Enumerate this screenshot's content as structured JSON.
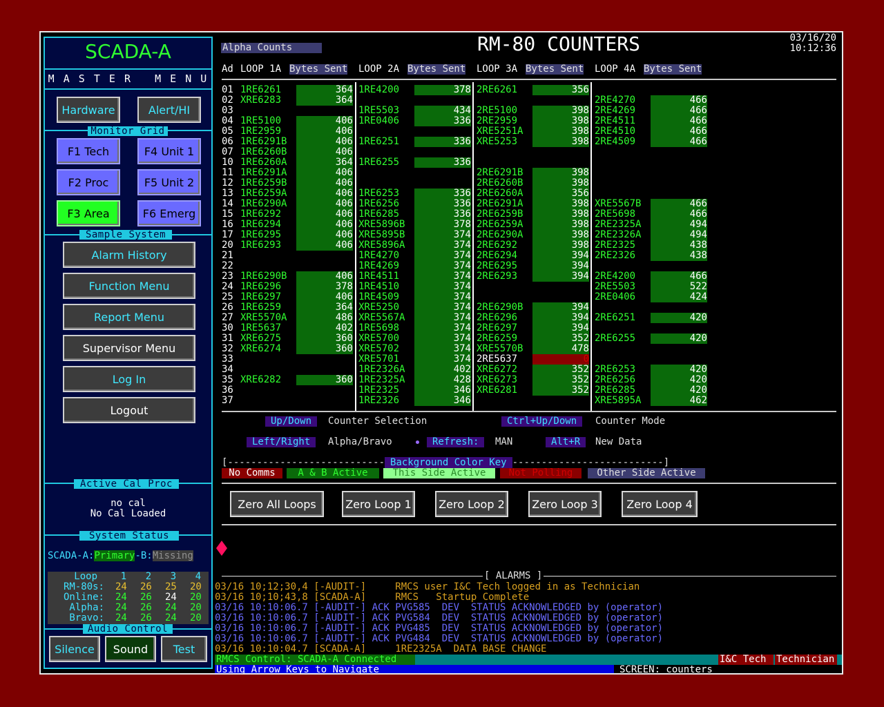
{
  "left": {
    "title": "SCADA-A",
    "master_menu": "M A S T E R   M E N U",
    "hardware": "Hardware",
    "alert": "Alert/HI",
    "monitor_grid": "Monitor Grid",
    "f1": "F1 Tech",
    "f2": "F2 Proc",
    "f3": "F3 Area",
    "f4": "F4 Unit 1",
    "f5": "F5 Unit 2",
    "f6": "F6 Emerg",
    "sample_system": "Sample System",
    "menu": [
      "Alarm History",
      "Function Menu",
      "Report Menu",
      "Supervisor Menu",
      "Log In",
      "Logout"
    ],
    "active_cal": "Active Cal Proc",
    "cal1": "no cal",
    "cal2": "No Cal Loaded",
    "system_status": "System  Status",
    "status_prefix": "SCADA-A:",
    "status_primary": "Primary",
    "status_b": "-B:",
    "status_missing": "Missing",
    "loop_table": {
      "header": [
        "Loop",
        "1",
        "2",
        "3",
        "4"
      ],
      "rows": [
        {
          "label": "RM-80s:",
          "v": [
            "24",
            "26",
            "25",
            "20"
          ]
        },
        {
          "label": "Online:",
          "v": [
            "24",
            "26",
            "24",
            "20"
          ]
        },
        {
          "label": "Alpha:",
          "v": [
            "24",
            "26",
            "24",
            "20"
          ]
        },
        {
          "label": "Bravo:",
          "v": [
            "24",
            "26",
            "24",
            "20"
          ]
        }
      ]
    },
    "audio_control": "Audio Control",
    "silence": "Silence",
    "sound": "Sound",
    "test": "Test"
  },
  "header": {
    "alpha_counts": "Alpha Counts",
    "title": "RM-80 COUNTERS",
    "date": "03/16/20",
    "time": "10:12:36"
  },
  "columns": {
    "ad": "Ad",
    "loop_labels": [
      "LOOP 1A",
      "LOOP 2A",
      "LOOP 3A",
      "LOOP 4A"
    ],
    "bytes_sent": "Bytes Sent"
  },
  "addresses": [
    "01",
    "02",
    "03",
    "04",
    "05",
    "06",
    "07",
    "10",
    "11",
    "12",
    "13",
    "14",
    "15",
    "16",
    "17",
    "20",
    "21",
    "22",
    "23",
    "24",
    "25",
    "26",
    "27",
    "30",
    "31",
    "32",
    "33",
    "34",
    "35",
    "36",
    "37"
  ],
  "loops": [
    {
      "loop": "1A",
      "rows": [
        {
          "r": 0,
          "name": "1RE6261",
          "val": "364"
        },
        {
          "r": 1,
          "name": "XRE6283",
          "val": "364"
        },
        {
          "r": 3,
          "name": "1RE5100",
          "val": "406"
        },
        {
          "r": 4,
          "name": "1RE2959",
          "val": "406"
        },
        {
          "r": 5,
          "name": "1RE6291B",
          "val": "406"
        },
        {
          "r": 6,
          "name": "1RE6260B",
          "val": "406"
        },
        {
          "r": 7,
          "name": "1RE6260A",
          "val": "364"
        },
        {
          "r": 8,
          "name": "1RE6291A",
          "val": "406"
        },
        {
          "r": 9,
          "name": "1RE6259B",
          "val": "406"
        },
        {
          "r": 10,
          "name": "1RE6259A",
          "val": "406"
        },
        {
          "r": 11,
          "name": "1RE6290A",
          "val": "406"
        },
        {
          "r": 12,
          "name": "1RE6292",
          "val": "406"
        },
        {
          "r": 13,
          "name": "1RE6294",
          "val": "406"
        },
        {
          "r": 14,
          "name": "1RE6295",
          "val": "406"
        },
        {
          "r": 15,
          "name": "1RE6293",
          "val": "406"
        },
        {
          "r": 18,
          "name": "1RE6290B",
          "val": "406"
        },
        {
          "r": 19,
          "name": "1RE6296",
          "val": "378"
        },
        {
          "r": 20,
          "name": "1RE6297",
          "val": "406"
        },
        {
          "r": 21,
          "name": "1RE6259",
          "val": "364"
        },
        {
          "r": 22,
          "name": "XRE5570A",
          "val": "486"
        },
        {
          "r": 23,
          "name": "1RE5637",
          "val": "402"
        },
        {
          "r": 24,
          "name": "XRE6275",
          "val": "360"
        },
        {
          "r": 25,
          "name": "XRE6274",
          "val": "360"
        },
        {
          "r": 28,
          "name": "XRE6282",
          "val": "360"
        }
      ]
    },
    {
      "loop": "2A",
      "rows": [
        {
          "r": 0,
          "name": "1RE4200",
          "val": "378"
        },
        {
          "r": 2,
          "name": "1RE5503",
          "val": "434"
        },
        {
          "r": 3,
          "name": "1RE0406",
          "val": "336"
        },
        {
          "r": 5,
          "name": "1RE6251",
          "val": "336"
        },
        {
          "r": 7,
          "name": "1RE6255",
          "val": "336"
        },
        {
          "r": 10,
          "name": "1RE6253",
          "val": "336"
        },
        {
          "r": 11,
          "name": "1RE6256",
          "val": "336"
        },
        {
          "r": 12,
          "name": "1RE6285",
          "val": "336"
        },
        {
          "r": 13,
          "name": "XRE5896B",
          "val": "378"
        },
        {
          "r": 14,
          "name": "XRE5895B",
          "val": "374"
        },
        {
          "r": 15,
          "name": "XRE5896A",
          "val": "374"
        },
        {
          "r": 16,
          "name": "1RE4270",
          "val": "374"
        },
        {
          "r": 17,
          "name": "1RE4269",
          "val": "374"
        },
        {
          "r": 18,
          "name": "1RE4511",
          "val": "374"
        },
        {
          "r": 19,
          "name": "1RE4510",
          "val": "374"
        },
        {
          "r": 20,
          "name": "1RE4509",
          "val": "374"
        },
        {
          "r": 21,
          "name": "XRE5250",
          "val": "374"
        },
        {
          "r": 22,
          "name": "XRE5567A",
          "val": "374"
        },
        {
          "r": 23,
          "name": "1RE5698",
          "val": "374"
        },
        {
          "r": 24,
          "name": "XRE5700",
          "val": "374"
        },
        {
          "r": 25,
          "name": "XRE5702",
          "val": "374"
        },
        {
          "r": 26,
          "name": "XRE5701",
          "val": "374"
        },
        {
          "r": 27,
          "name": "1RE2326A",
          "val": "402"
        },
        {
          "r": 28,
          "name": "1RE2325A",
          "val": "428"
        },
        {
          "r": 29,
          "name": "1RE2325",
          "val": "346"
        },
        {
          "r": 30,
          "name": "1RE2326",
          "val": "346"
        }
      ]
    },
    {
      "loop": "3A",
      "rows": [
        {
          "r": 0,
          "name": "2RE6261",
          "val": "356"
        },
        {
          "r": 2,
          "name": "2RE5100",
          "val": "398"
        },
        {
          "r": 3,
          "name": "2RE2959",
          "val": "398"
        },
        {
          "r": 4,
          "name": "XRE5251A",
          "val": "398"
        },
        {
          "r": 5,
          "name": "XRE5253",
          "val": "398"
        },
        {
          "r": 8,
          "name": "2RE6291B",
          "val": "398"
        },
        {
          "r": 9,
          "name": "2RE6260B",
          "val": "398"
        },
        {
          "r": 10,
          "name": "2RE6260A",
          "val": "356"
        },
        {
          "r": 11,
          "name": "2RE6291A",
          "val": "398"
        },
        {
          "r": 12,
          "name": "2RE6259B",
          "val": "398"
        },
        {
          "r": 13,
          "name": "2RE6259A",
          "val": "398"
        },
        {
          "r": 14,
          "name": "2RE6290A",
          "val": "398"
        },
        {
          "r": 15,
          "name": "2RE6292",
          "val": "398"
        },
        {
          "r": 16,
          "name": "2RE6294",
          "val": "394"
        },
        {
          "r": 17,
          "name": "2RE6295",
          "val": "394"
        },
        {
          "r": 18,
          "name": "2RE6293",
          "val": "394"
        },
        {
          "r": 21,
          "name": "2RE6290B",
          "val": "394"
        },
        {
          "r": 22,
          "name": "2RE6296",
          "val": "394"
        },
        {
          "r": 23,
          "name": "2RE6297",
          "val": "394"
        },
        {
          "r": 24,
          "name": "2RE6259",
          "val": "352"
        },
        {
          "r": 25,
          "name": "XRE5570B",
          "val": "478"
        },
        {
          "r": 26,
          "name": "2RE5637",
          "val": "0",
          "state": "not-polling"
        },
        {
          "r": 27,
          "name": "XRE6272",
          "val": "352"
        },
        {
          "r": 28,
          "name": "XRE6273",
          "val": "352"
        },
        {
          "r": 29,
          "name": "XRE6281",
          "val": "352"
        }
      ]
    },
    {
      "loop": "4A",
      "rows": [
        {
          "r": 1,
          "name": "2RE4270",
          "val": "466"
        },
        {
          "r": 2,
          "name": "2RE4269",
          "val": "466"
        },
        {
          "r": 3,
          "name": "2RE4511",
          "val": "466"
        },
        {
          "r": 4,
          "name": "2RE4510",
          "val": "466"
        },
        {
          "r": 5,
          "name": "2RE4509",
          "val": "466"
        },
        {
          "r": 11,
          "name": "XRE5567B",
          "val": "466"
        },
        {
          "r": 12,
          "name": "2RE5698",
          "val": "466"
        },
        {
          "r": 13,
          "name": "2RE2325A",
          "val": "494"
        },
        {
          "r": 14,
          "name": "2RE2326A",
          "val": "494"
        },
        {
          "r": 15,
          "name": "2RE2325",
          "val": "438"
        },
        {
          "r": 16,
          "name": "2RE2326",
          "val": "438"
        },
        {
          "r": 18,
          "name": "2RE4200",
          "val": "466"
        },
        {
          "r": 19,
          "name": "2RE5503",
          "val": "522"
        },
        {
          "r": 20,
          "name": "2RE0406",
          "val": "424"
        },
        {
          "r": 22,
          "name": "2RE6251",
          "val": "420"
        },
        {
          "r": 24,
          "name": "2RE6255",
          "val": "420"
        },
        {
          "r": 27,
          "name": "2RE6253",
          "val": "420"
        },
        {
          "r": 28,
          "name": "2RE6256",
          "val": "420"
        },
        {
          "r": 29,
          "name": "2RE6285",
          "val": "420"
        },
        {
          "r": 30,
          "name": "XRE5895A",
          "val": "462"
        }
      ]
    }
  ],
  "keys": {
    "updown": "Up/Down",
    "updown_desc": "Counter Selection",
    "ctrl": "Ctrl+Up/Down",
    "ctrl_desc": "Counter Mode",
    "leftright": "Left/Right",
    "leftright_desc": "Alpha/Bravo",
    "refresh": "Refresh:",
    "refresh_val": "MAN",
    "altr": "Alt+R",
    "altr_desc": "New Data"
  },
  "color_key": {
    "left_bracket": "[---------------------------",
    "title": "Background Color Key",
    "right_bracket": "--------------------------]",
    "items": [
      "No Comms",
      "A & B Active",
      "This Side Active",
      "Not Polling",
      "Other Side Active"
    ]
  },
  "zero_buttons": [
    "Zero All Loops",
    "Zero Loop 1",
    "Zero Loop 2",
    "Zero Loop 3",
    "Zero Loop 4"
  ],
  "alarms": {
    "title": "[ ALARMS ]",
    "rows": [
      {
        "text": "03/16 10;12;30,4 [-AUDIT-]     RMCS user I&C Tech logged in as Technician",
        "color": "#d8a020"
      },
      {
        "text": "03/16 10;10;43,8 [SCADA-A]     RMCS   Startup Complete",
        "color": "#d8a020"
      },
      {
        "text": "03/16 10:10:06.7 [-AUDIT-] ACK PVG585  DEV  STATUS ACKNOWLEDGED by (operator)",
        "color": "#6a6aff"
      },
      {
        "text": "03/16 10:10:06.7 [-AUDIT-] ACK PVG584  DEV  STATUS ACKNOWLEDGED by (operator)",
        "color": "#6a6aff"
      },
      {
        "text": "03/16 10:10:06.7 [-AUDIT-] ACK PVG485  DEV  STATUS ACKNOWLEDGED by (operator)",
        "color": "#6a6aff"
      },
      {
        "text": "03/16 10:10:06.7 [-AUDIT-] ACK PVG484  DEV  STATUS ACKNOWLEDGED by (operator)",
        "color": "#6a6aff"
      },
      {
        "text": "03/16 10:10:04.7 [SCADA-A]     1RE2325A  DATA BASE CHANGE",
        "color": "#d8a020"
      }
    ]
  },
  "statusbar": {
    "control": "RMCS Control: SCADA-A Connected",
    "user": "I&C Tech",
    "role": "Technician",
    "hint": "Using Arrow Keys to Navigate",
    "screen": "SCREEN: counters"
  }
}
